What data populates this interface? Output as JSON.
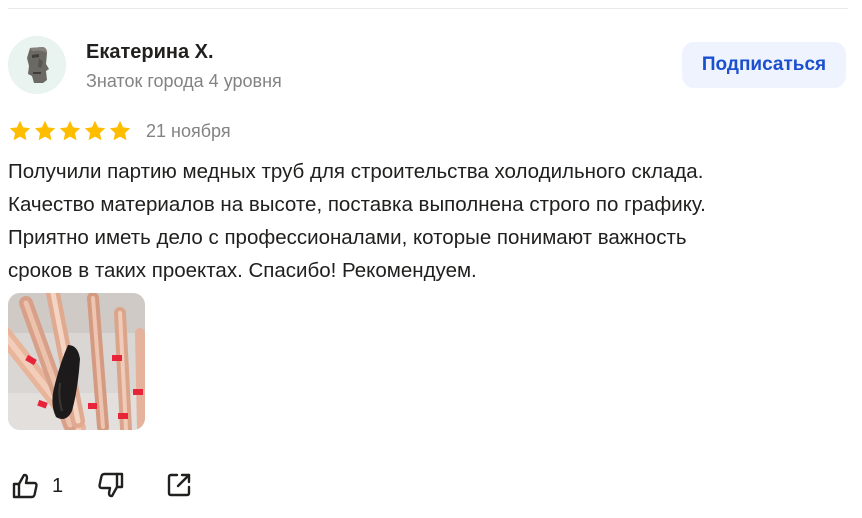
{
  "review": {
    "author": {
      "name": "Екатерина Х.",
      "level": "Знаток города 4 уровня",
      "avatar_icon": "moai-statue-icon"
    },
    "subscribe_label": "Подписаться",
    "rating": 5,
    "date": "21 ноября",
    "text": "Получили партию медных труб для строительства холодильного склада.\nКачество материалов на высоте, поставка выполнена строго по графику.\nПриятно иметь дело с профессионалами, которые понимают важность\nсроков в таких проектах. Спасибо! Рекомендуем.",
    "photo_count": 1,
    "likes": "1",
    "icons": {
      "like": "thumbs-up-icon",
      "dislike": "thumbs-down-icon",
      "share": "share-icon",
      "star": "star-icon"
    }
  },
  "colors": {
    "star": "#ffbd00",
    "subscribe_bg": "#eef3fd",
    "subscribe_text": "#1a4fcf",
    "muted_text": "#838383",
    "main_text": "#21201f"
  }
}
